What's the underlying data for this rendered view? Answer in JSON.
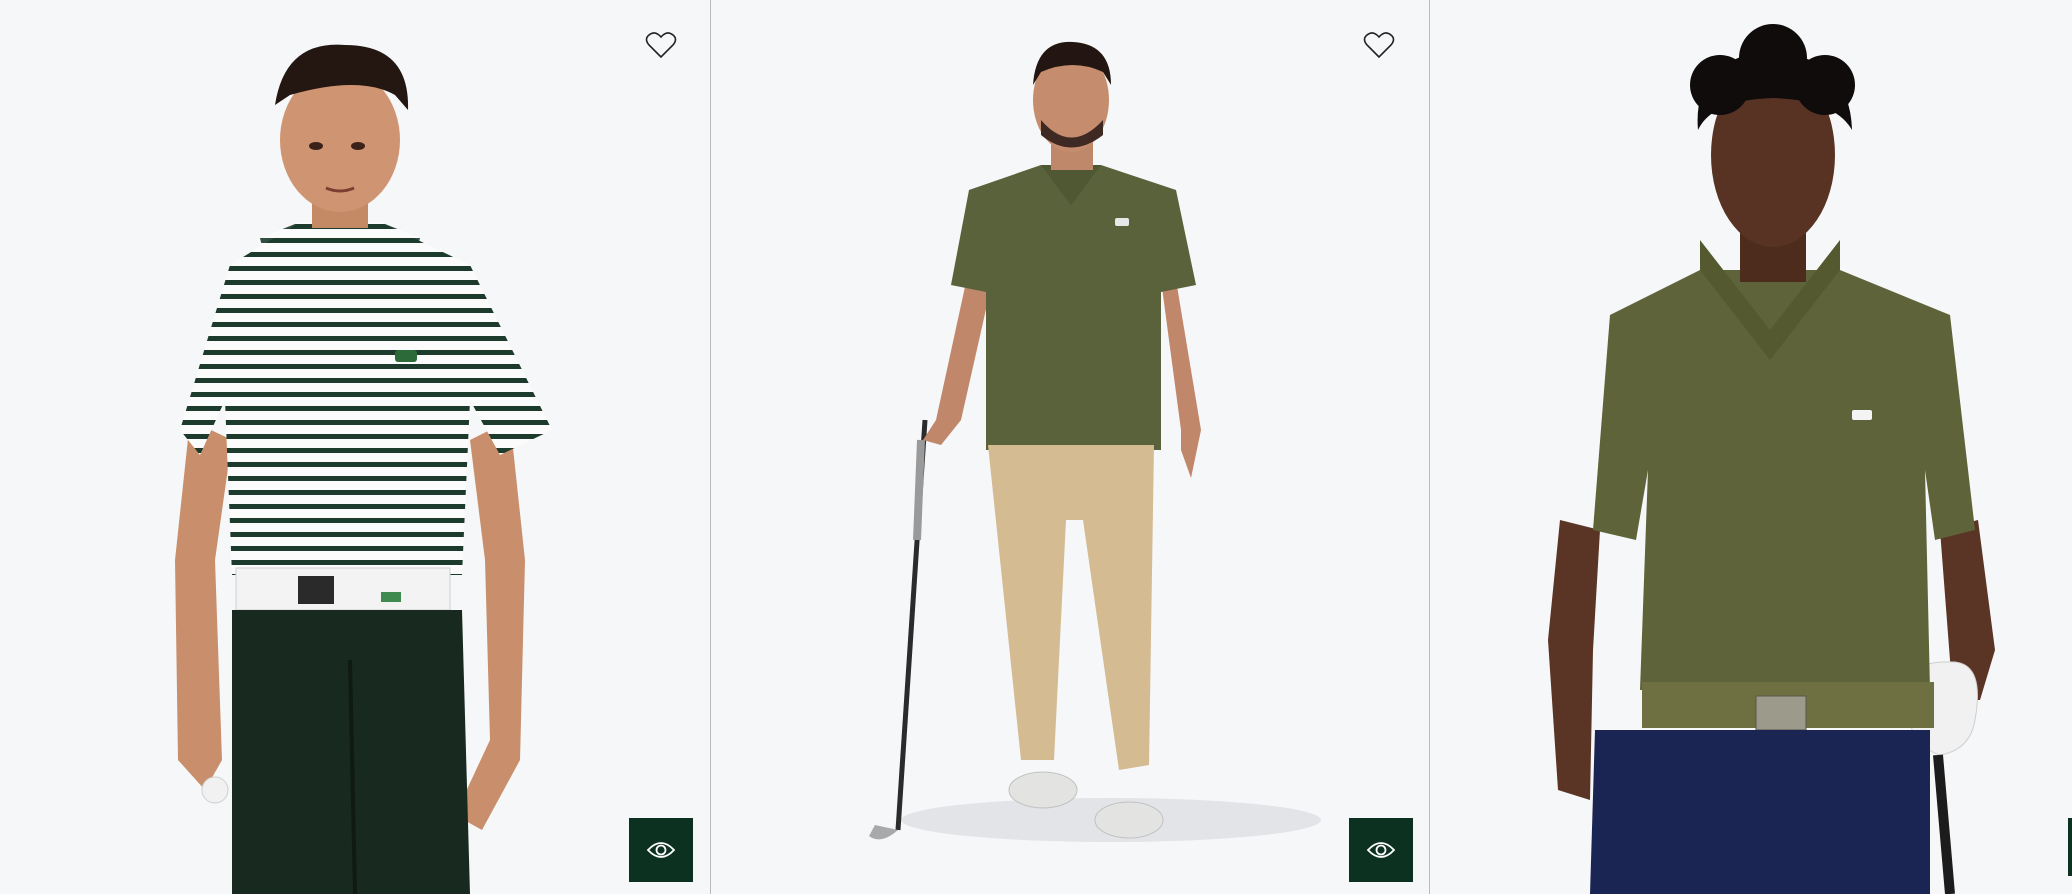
{
  "products": [
    {
      "name": "Striped golf polo shirt with white belt and dark green trousers",
      "image_alt": "Model wearing a white and green striped polo shirt",
      "colors": {
        "shirt": "#ffffff",
        "stripe": "#1d3b2c",
        "pants": "#18291f",
        "belt": "#f3f3f3"
      },
      "actions": {
        "wishlist_icon": "heart-outline",
        "quickview_icon": "eye"
      }
    },
    {
      "name": "Olive golf polo shirt with beige trousers",
      "image_alt": "Golfer holding a club, wearing an olive polo and beige trousers",
      "colors": {
        "shirt": "#59623a",
        "pants": "#d4bb92",
        "shoes": "#e3e4e2"
      },
      "actions": {
        "wishlist_icon": "heart-outline",
        "quickview_icon": "eye"
      }
    },
    {
      "name": "Olive crocodile print golf polo shirt with navy trousers",
      "image_alt": "Model in olive printed polo with olive belt and navy trousers",
      "colors": {
        "shirt": "#5e6339",
        "pants": "#1b2554",
        "belt": "#6e7042"
      },
      "actions": {
        "wishlist_icon": "heart-outline",
        "quickview_icon": "eye"
      }
    }
  ],
  "accent_color": "#0c3121",
  "background_color": "#f6f7f9"
}
